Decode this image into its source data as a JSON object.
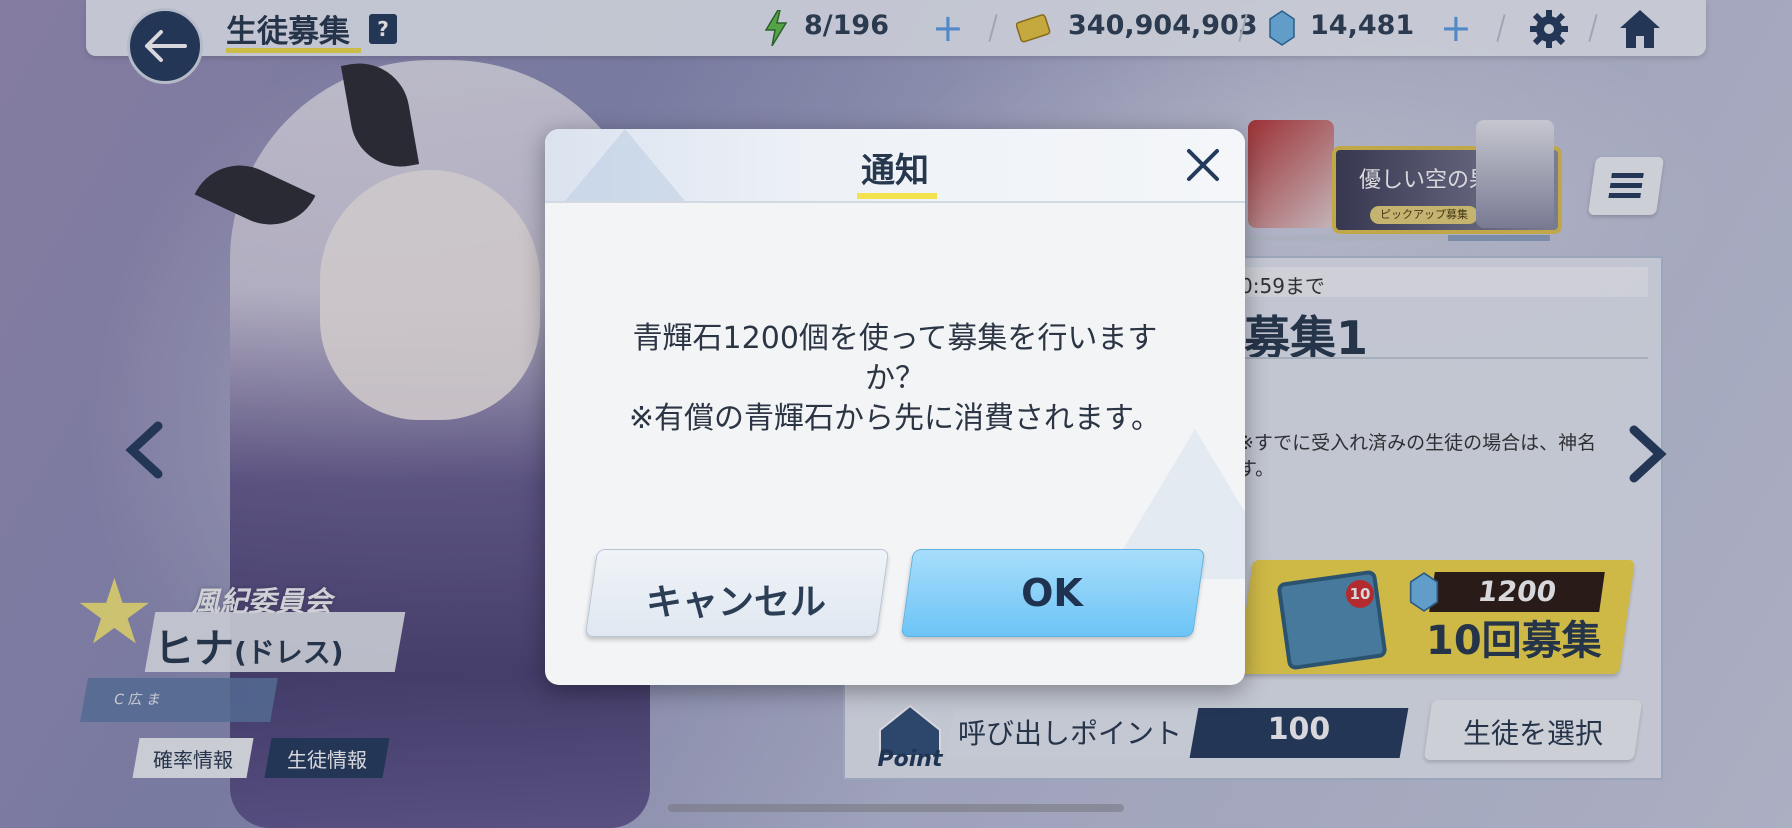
{
  "header": {
    "title": "生徒募集",
    "help": "?",
    "ap": "8/196",
    "credits": "340,904,903",
    "pyroxene": "14,481"
  },
  "banners": {
    "featured_text": "優しい空の果てに",
    "featured_pill": "ピックアップ募集"
  },
  "panel": {
    "deadline": "0:59まで",
    "recruit_title": "募集1",
    "note": "※すでに受入れ済みの生徒の場合は、神名\nす。",
    "gacha10_price": "1200",
    "gacha10_label": "10回募集",
    "ticket_badge": "10",
    "point_label": "呼び出しポイント",
    "point_value": "100",
    "select_label": "生徒を選択",
    "point_icon_text": "Point"
  },
  "character": {
    "affiliation": "風紀委員会",
    "name": "ヒナ",
    "name_suffix": "(ドレス)",
    "tag": "C 広 ま",
    "btn_rate": "確率情報",
    "btn_student": "生徒情報"
  },
  "dialog": {
    "title": "通知",
    "message_line1": "青輝石1200個を使って募集を行います",
    "message_line2": "か？",
    "message_line3": "※有償の青輝石から先に消費されます。",
    "cancel": "キャンセル",
    "ok": "OK"
  },
  "colors": {
    "navy": "#243a5c",
    "accent_yellow": "#f1e24e",
    "ok_blue": "#6cc4f6",
    "gacha_yellow": "#f3d94a"
  },
  "icons": {
    "back": "arrow-left-icon",
    "ap": "lightning-icon",
    "credits": "credit-card-icon",
    "pyroxene": "gem-icon",
    "settings": "gear-icon",
    "home": "home-icon",
    "close": "close-icon",
    "menu": "menu-icon",
    "nav_prev": "chevron-left-icon",
    "nav_next": "chevron-right-icon"
  }
}
